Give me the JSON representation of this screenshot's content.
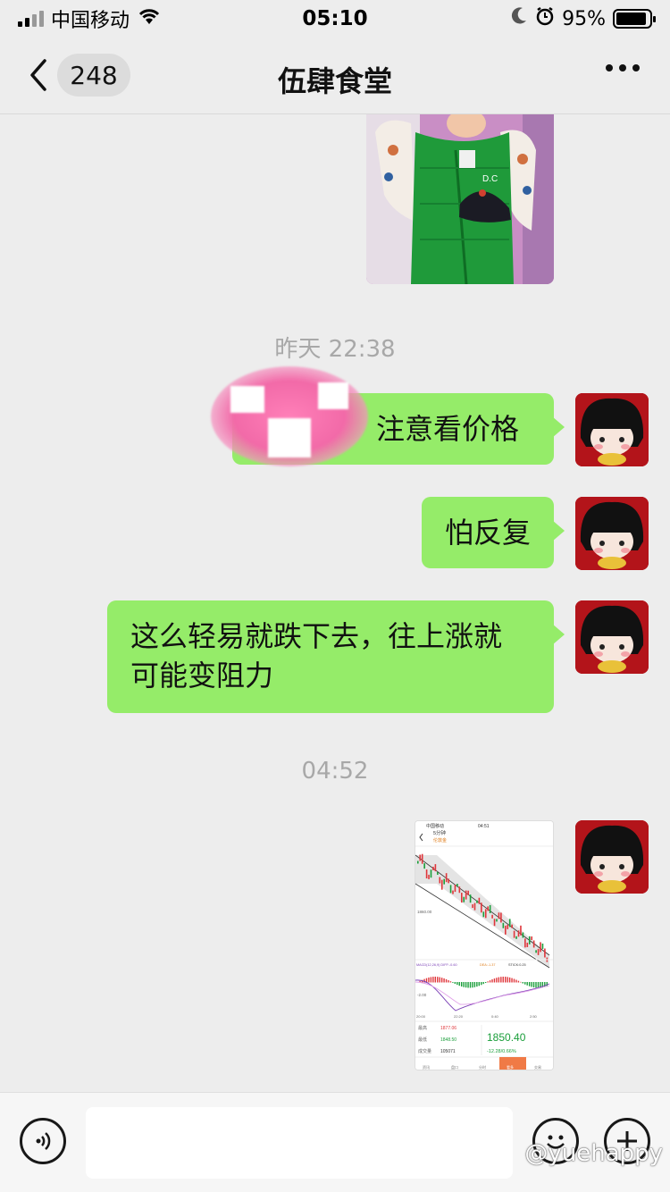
{
  "status_bar": {
    "carrier": "中国移动",
    "time": "05:10",
    "battery": "95%"
  },
  "nav": {
    "unread_count": "248",
    "title": "伍肆食堂"
  },
  "messages": {
    "timestamp_1": "昨天 22:38",
    "msg_1": "注意看价格",
    "msg_2": "怕反复",
    "msg_3_line_1": "这么轻易就跌下去，往上涨就",
    "msg_3_line_2": "可能变阻力",
    "timestamp_2": "04:52"
  },
  "stock_screenshot": {
    "carrier": "中国移动",
    "time": "04:51",
    "period": "5分钟",
    "name": "伦敦金",
    "price_mark": "1860.00",
    "macd_label": "MACD(12,26,9) DIFF:-0.60",
    "dea_label": "DEA:-1.37",
    "stick_label": "STICK:0.25",
    "macd_axis": "-2.00",
    "x_ticks": [
      "20:00",
      "22:20",
      "0:40",
      "2:50"
    ],
    "high_label": "最高",
    "high_value": "1877.06",
    "low_label": "最低",
    "low_value": "1848.50",
    "vol_label": "成交量",
    "vol_value": "105071",
    "last_price": "1850.40",
    "change": "-12.28/0.66%",
    "tabs": [
      "资讯",
      "盘口",
      "分时",
      "看多",
      "交易"
    ]
  },
  "watermark": "@yuehappy",
  "colors": {
    "bubble_green": "#95ec69",
    "background": "#ededed",
    "price_red": "#e0363b",
    "price_green": "#1a9e3a"
  }
}
